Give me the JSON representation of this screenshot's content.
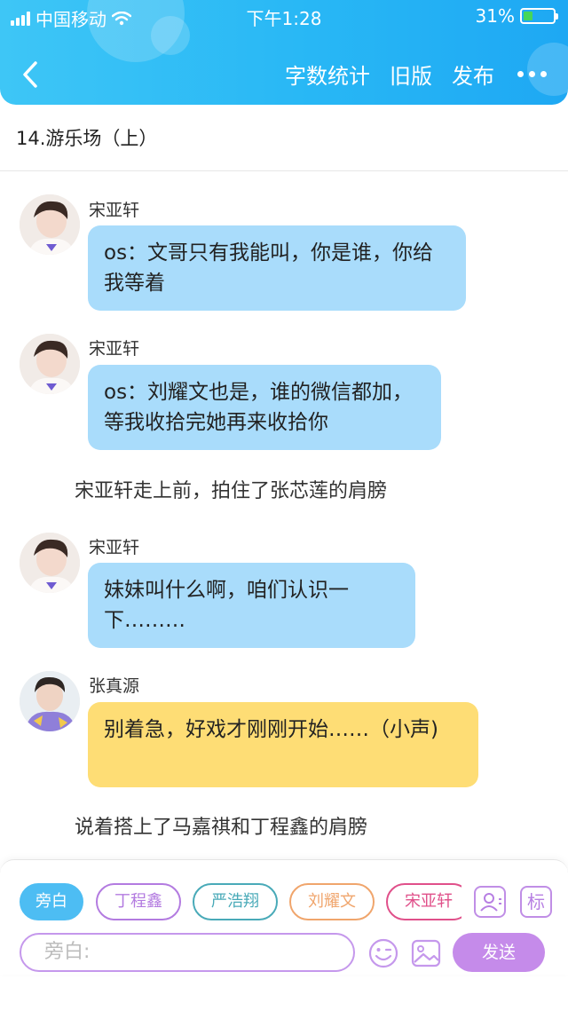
{
  "status_bar": {
    "carrier": "中国移动",
    "time": "下午1:28",
    "battery": "31%",
    "battery_level": 0.31
  },
  "nav": {
    "word_count": "字数统计",
    "old_version": "旧版",
    "publish": "发布",
    "back_icon": "chevron-left-icon",
    "more_icon": "more-dots-icon"
  },
  "chapter_title": "14.游乐场（上）",
  "messages": [
    {
      "type": "dialog",
      "speaker": "宋亚轩",
      "text": "os：文哥只有我能叫，你是谁，你给我等着",
      "color": "#a9dcfb"
    },
    {
      "type": "dialog",
      "speaker": "宋亚轩",
      "text": "os：刘耀文也是，谁的微信都加，等我收拾完她再来收拾你",
      "color": "#a9dcfb"
    },
    {
      "type": "narration",
      "text": "宋亚轩走上前，拍住了张芯莲的肩膀"
    },
    {
      "type": "dialog",
      "speaker": "宋亚轩",
      "text": "妹妹叫什么啊，咱们认识一下………",
      "color": "#a9dcfb"
    },
    {
      "type": "dialog",
      "speaker": "张真源",
      "text": "别着急，好戏才刚刚开始……（小声)",
      "color": "#fedd75"
    },
    {
      "type": "narration",
      "text": "说着搭上了马嘉祺和丁程鑫的肩膀"
    }
  ],
  "composer": {
    "chips": [
      {
        "label": "旁白",
        "color": "#4dbdf3",
        "active": true
      },
      {
        "label": "丁程鑫",
        "color": "#b37be0",
        "active": false
      },
      {
        "label": "严浩翔",
        "color": "#49aab8",
        "active": false
      },
      {
        "label": "刘耀文",
        "color": "#f0a56c",
        "active": false
      },
      {
        "label": "宋亚轩",
        "color": "#e0508a",
        "active": false
      }
    ],
    "tool_label": "标",
    "input_placeholder": "旁白:",
    "send_label": "发送"
  }
}
